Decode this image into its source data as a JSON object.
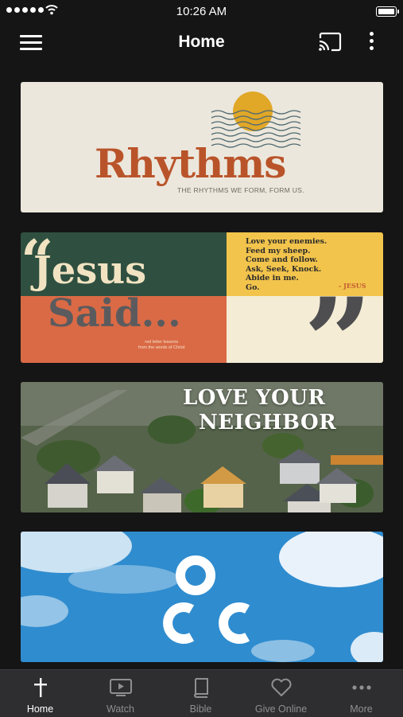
{
  "status_bar": {
    "time": "10:26 AM"
  },
  "header": {
    "title": "Home"
  },
  "cards": [
    {
      "title": "Rhythms",
      "tagline": "THE RHYTHMS WE FORM, FORM US."
    },
    {
      "title_line1": "Jesus",
      "title_line2": "Said...",
      "fine_print_1": "red letter lessons",
      "fine_print_2": "from the words of Christ",
      "quotes": [
        "Love your enemies.",
        "Feed my sheep.",
        "Come and follow.",
        "Ask, Seek, Knock.",
        "Abide in me.",
        "Go."
      ],
      "attribution": "- JESUS"
    },
    {
      "title_line1": "LOVE YOUR",
      "title_line2": "NEIGHBOR"
    },
    {
      "logo": "OCC"
    }
  ],
  "tab_bar": {
    "tabs": [
      {
        "label": "Home",
        "icon": "cross-icon",
        "active": true
      },
      {
        "label": "Watch",
        "icon": "tv-play-icon",
        "active": false
      },
      {
        "label": "Bible",
        "icon": "book-icon",
        "active": false
      },
      {
        "label": "Give Online",
        "icon": "heart-icon",
        "active": false
      },
      {
        "label": "More",
        "icon": "more-dots-icon",
        "active": false
      }
    ]
  },
  "colors": {
    "background": "#151516",
    "tab_bar": "#2e2e30",
    "tab_active": "#ffffff",
    "tab_inactive": "#8f8f93",
    "rhythms_accent": "#b9542a",
    "jesus_green": "#2f5040",
    "jesus_orange": "#da6a45",
    "jesus_yellow": "#f2c44c",
    "occ_sky": "#2f8ccf"
  }
}
